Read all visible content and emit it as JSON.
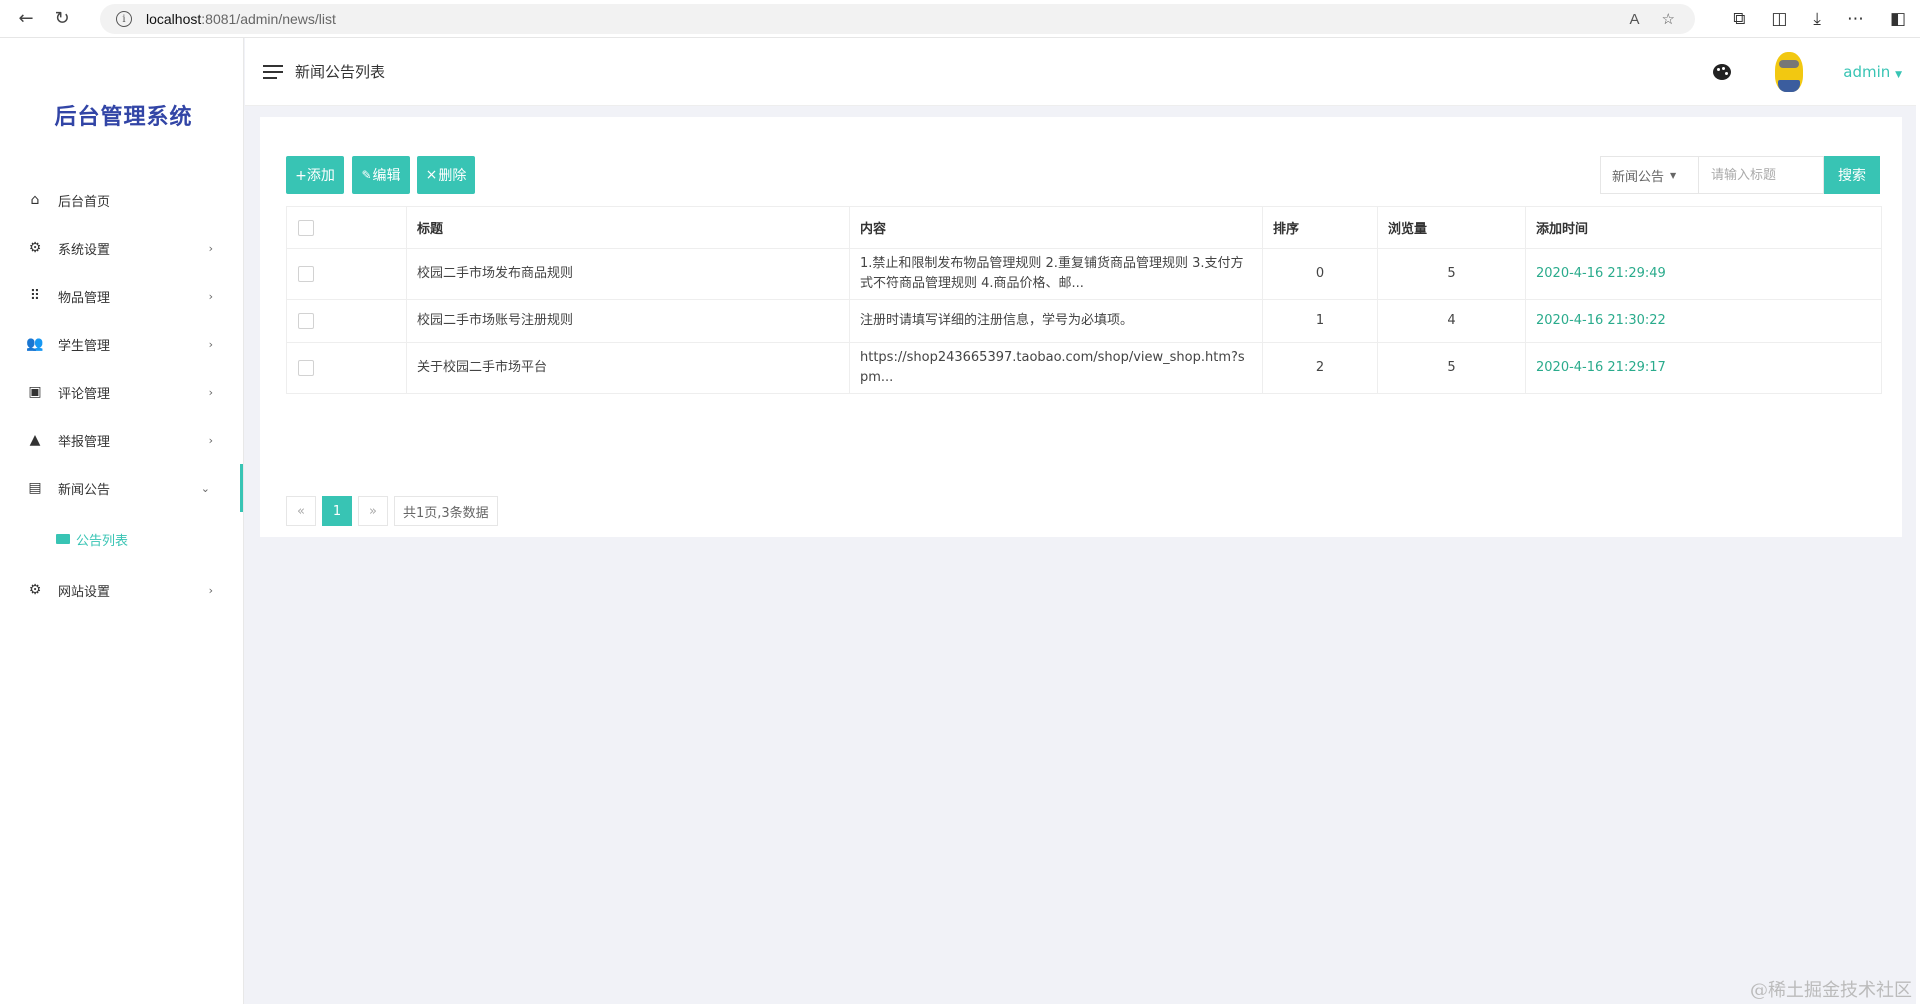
{
  "browser": {
    "url_host": "localhost",
    "url_path": ":8081/admin/news/list"
  },
  "app": {
    "brand": "后台管理系统",
    "page_title": "新闻公告列表",
    "user": "admin"
  },
  "sidebar": {
    "items": [
      {
        "label": "后台首页",
        "icon": "home-icon",
        "glyph": "⌂",
        "has_arrow": false
      },
      {
        "label": "系统设置",
        "icon": "gear-icon",
        "glyph": "⚙",
        "has_arrow": true
      },
      {
        "label": "物品管理",
        "icon": "grid-icon",
        "glyph": "⠿",
        "has_arrow": true
      },
      {
        "label": "学生管理",
        "icon": "users-icon",
        "glyph": "👥",
        "has_arrow": true
      },
      {
        "label": "评论管理",
        "icon": "comment-icon",
        "glyph": "▣",
        "has_arrow": true
      },
      {
        "label": "举报管理",
        "icon": "warning-icon",
        "glyph": "▲",
        "has_arrow": true
      },
      {
        "label": "新闻公告",
        "icon": "newspaper-icon",
        "glyph": "▤",
        "has_arrow": true,
        "expanded": true
      },
      {
        "label": "网站设置",
        "icon": "gear-icon",
        "glyph": "⚙",
        "has_arrow": true
      }
    ],
    "sub_item": "公告列表"
  },
  "toolbar": {
    "add": "+添加",
    "edit": "编辑",
    "delete": "删除",
    "category": "新闻公告",
    "search_placeholder": "请输入标题",
    "search": "搜索"
  },
  "table": {
    "headers": [
      "标题",
      "内容",
      "排序",
      "浏览量",
      "添加时间"
    ],
    "rows": [
      {
        "title": "校园二手市场发布商品规则",
        "content": "1.禁止和限制发布物品管理规则 2.重复铺货商品管理规则 3.支付方式不符商品管理规则 4.商品价格、邮...",
        "sort": "0",
        "views": "5",
        "time": "2020-4-16 21:29:49"
      },
      {
        "title": "校园二手市场账号注册规则",
        "content": "注册时请填写详细的注册信息，学号为必填项。",
        "sort": "1",
        "views": "4",
        "time": "2020-4-16 21:30:22"
      },
      {
        "title": "关于校园二手市场平台",
        "content": "https://shop243665397.taobao.com/shop/view_shop.htm?spm...",
        "sort": "2",
        "views": "5",
        "time": "2020-4-16 21:29:17"
      }
    ]
  },
  "pager": {
    "prev": "«",
    "current": "1",
    "next": "»",
    "info": "共1页,3条数据"
  },
  "watermark": "@稀土掘金技术社区",
  "colors": {
    "accent": "#38c4b4",
    "brand": "#3245a6",
    "time": "#2aab8c"
  }
}
